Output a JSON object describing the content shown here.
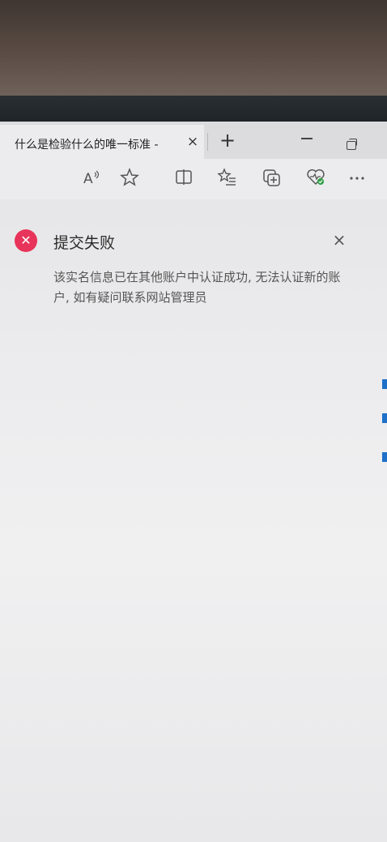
{
  "browser": {
    "tab_title": "什么是检验什么的唯一标准 -",
    "tab_close": "×",
    "new_tab": "+",
    "toolbar_icons": [
      "read-aloud-icon",
      "favorite-star-icon",
      "split-screen-icon",
      "favorites-list-icon",
      "collections-icon",
      "browser-essentials-icon",
      "more-icon"
    ]
  },
  "notice": {
    "title": "提交失败",
    "close": "×",
    "message": "该实名信息已在其他账户中认证成功, 无法认证新的账户, 如有疑问联系网站管理员",
    "error_color": "#e8345a"
  }
}
